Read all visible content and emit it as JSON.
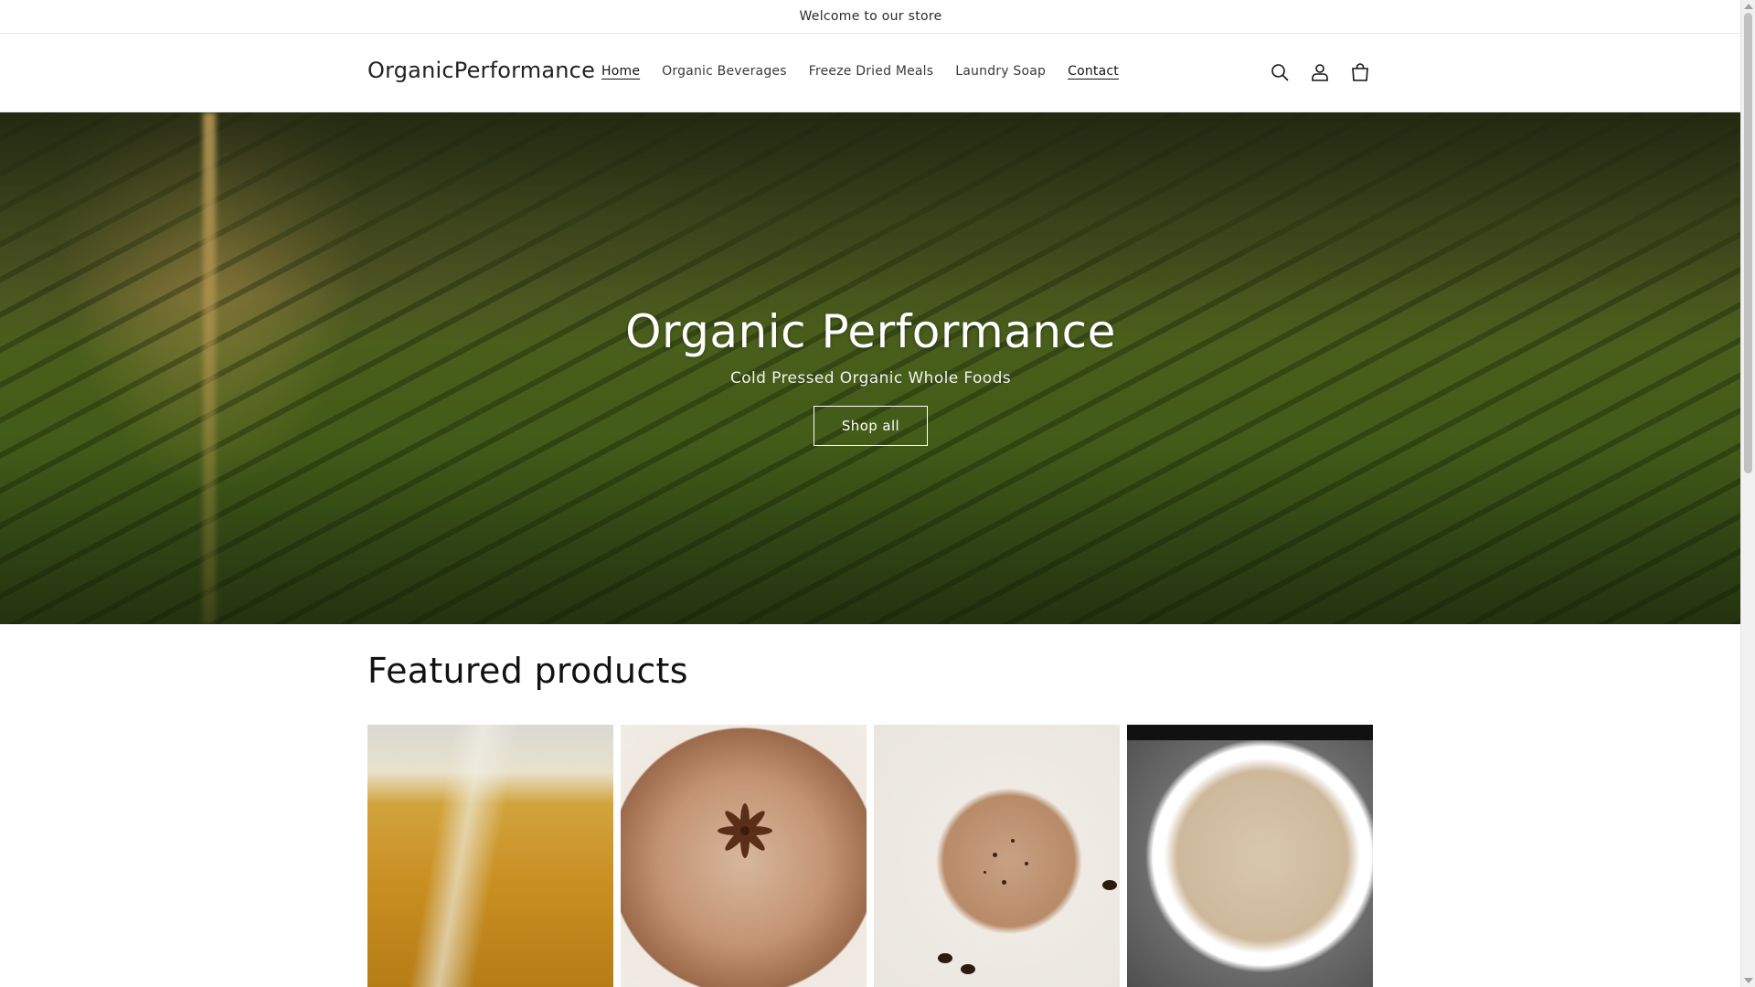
{
  "announcement": {
    "text": "Welcome to our store"
  },
  "header": {
    "logo": "OrganicPerformance",
    "nav": [
      {
        "label": "Home"
      },
      {
        "label": "Organic Beverages"
      },
      {
        "label": "Freeze Dried Meals"
      },
      {
        "label": "Laundry Soap"
      },
      {
        "label": "Contact"
      }
    ],
    "icons": [
      "search-icon",
      "account-icon",
      "cart-icon"
    ]
  },
  "hero": {
    "title": "Organic Performance",
    "subtitle": "Cold Pressed Organic Whole Foods",
    "button_label": "Shop all"
  },
  "featured": {
    "title": "Featured products",
    "products": [
      {
        "image": "honey-pouring"
      },
      {
        "image": "chai-latte-star-anise"
      },
      {
        "image": "cappuccino-cocoa"
      },
      {
        "image": "milk-tea-cup"
      }
    ]
  },
  "colors": {
    "text": "#121212",
    "background": "#ffffff",
    "hero_button_border": "#ffffff"
  }
}
